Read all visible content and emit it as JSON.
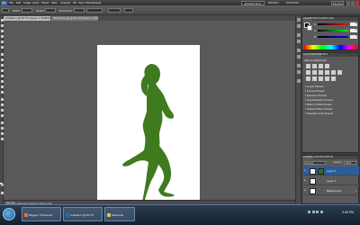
{
  "app": {
    "logo": "Ps",
    "menu": [
      "File",
      "Edit",
      "Image",
      "Layer",
      "Select",
      "Filter",
      "Analysis",
      "3D",
      "View",
      "Window",
      "Help"
    ],
    "workspace": "ESSENTIALS",
    "design": "DESIGN",
    "painting": "PAINTING",
    "cs_live": "CS Live"
  },
  "options_bar": {
    "width_label": "Width:",
    "height_label": "Height:",
    "resolution_label": "Resolution:",
    "units": "pixels/inch"
  },
  "document": {
    "tabs": [
      {
        "label": "Untitled-1 @ 66.7% (Layer 1, RGB/8) *",
        "active": true
      },
      {
        "label": "Silhouette.jpg @ 66.7% (Layer 0, RGB/8)",
        "active": false
      }
    ],
    "zoom": "66.67%",
    "doc_info": "Exposure works in 32-bit only"
  },
  "panels": {
    "color": {
      "tabs": [
        "COLOR",
        "SWATCHES",
        "STYLES"
      ],
      "channels": [
        {
          "label": "R",
          "value": "0"
        },
        {
          "label": "G",
          "value": "0"
        },
        {
          "label": "B",
          "value": "0"
        }
      ]
    },
    "adjustments": {
      "tabs": [
        "ADJUSTMENTS",
        "MASKS"
      ],
      "heading": "Add an adjustment",
      "presets": [
        "Levels Presets",
        "Curves Presets",
        "Exposure Presets",
        "Hue/Saturation Presets",
        "Black & White Presets",
        "Channel Mixer Presets",
        "Selective Color Presets"
      ]
    },
    "layers": {
      "tabs": [
        "LAYERS",
        "CHANNELS",
        "PATHS"
      ],
      "blend_mode": "Normal",
      "opacity_label": "Opacity:",
      "opacity": "100%",
      "items": [
        {
          "name": "Layer 2",
          "selected": true,
          "has_mask": true
        },
        {
          "name": "Layer 1",
          "selected": false,
          "has_mask": false
        },
        {
          "name": "Background",
          "selected": false,
          "has_mask": false,
          "locked": true
        }
      ]
    }
  },
  "taskbar": {
    "tasks": [
      {
        "label": "Blogger: Photoshop",
        "color": "#e8752a"
      },
      {
        "label": "Untitled-1 @ 66.7%",
        "color": "#2a6fb0"
      },
      {
        "label": "Silhouette",
        "color": "#d9c36a"
      }
    ],
    "clock": "3:48 PM"
  },
  "colors": {
    "silhouette": "#3f7a1f",
    "selection": "#2b5c9e"
  }
}
